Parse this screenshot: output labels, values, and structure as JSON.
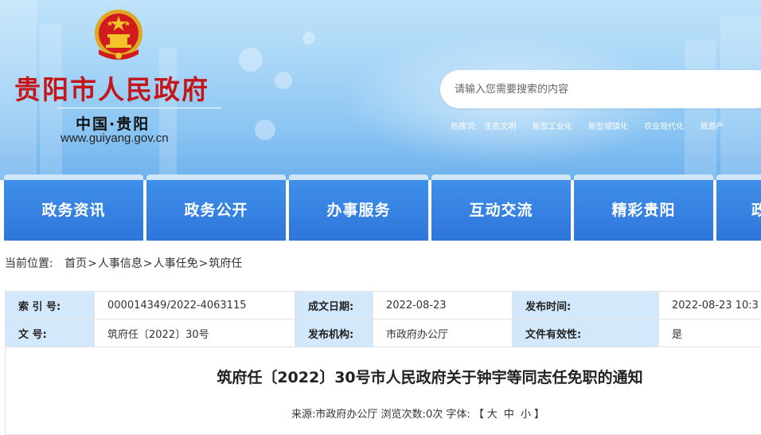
{
  "site": {
    "title": "贵阳市人民政府",
    "subtitle": "中国·贵阳",
    "domain": "www.guiyang.gov.cn"
  },
  "search": {
    "placeholder": "请输入您需要搜索的内容",
    "hot_label": "热搜词:",
    "hot_words": [
      "生态文明",
      "新型工业化",
      "新型城镇化",
      "农业现代化",
      "旅游产"
    ]
  },
  "nav": {
    "items": [
      "政务资讯",
      "政务公开",
      "办事服务",
      "互动交流",
      "精彩贵阳",
      "政"
    ]
  },
  "breadcrumb": {
    "label": "当前位置:",
    "items": [
      "首页",
      "人事信息",
      "人事任免",
      "筑府任"
    ],
    "separator": ">"
  },
  "meta": {
    "index_no_label": "索 引 号:",
    "index_no": "000014349/2022-4063115",
    "created_date_label": "成文日期:",
    "created_date": "2022-08-23",
    "publish_time_label": "发布时间:",
    "publish_time": "2022-08-23 10:3",
    "doc_no_label": "文 号:",
    "doc_no": "筑府任〔2022〕30号",
    "issuer_label": "发布机构:",
    "issuer": "市政府办公厅",
    "validity_label": "文件有效性:",
    "validity": "是"
  },
  "document": {
    "title": "筑府任〔2022〕30号市人民政府关于钟宇等同志任免职的通知",
    "source_label": "来源:",
    "source": "市政府办公厅",
    "views_label": "浏览次数:",
    "views": "0次",
    "font_label": "字体:",
    "bracket_open": "【",
    "size_large": "大",
    "size_medium": "中",
    "size_small": "小",
    "bracket_close": "】"
  },
  "colors": {
    "title_red": "#c3171b",
    "nav_blue": "#3a86e4",
    "table_key_bg": "#d3e8fa"
  }
}
